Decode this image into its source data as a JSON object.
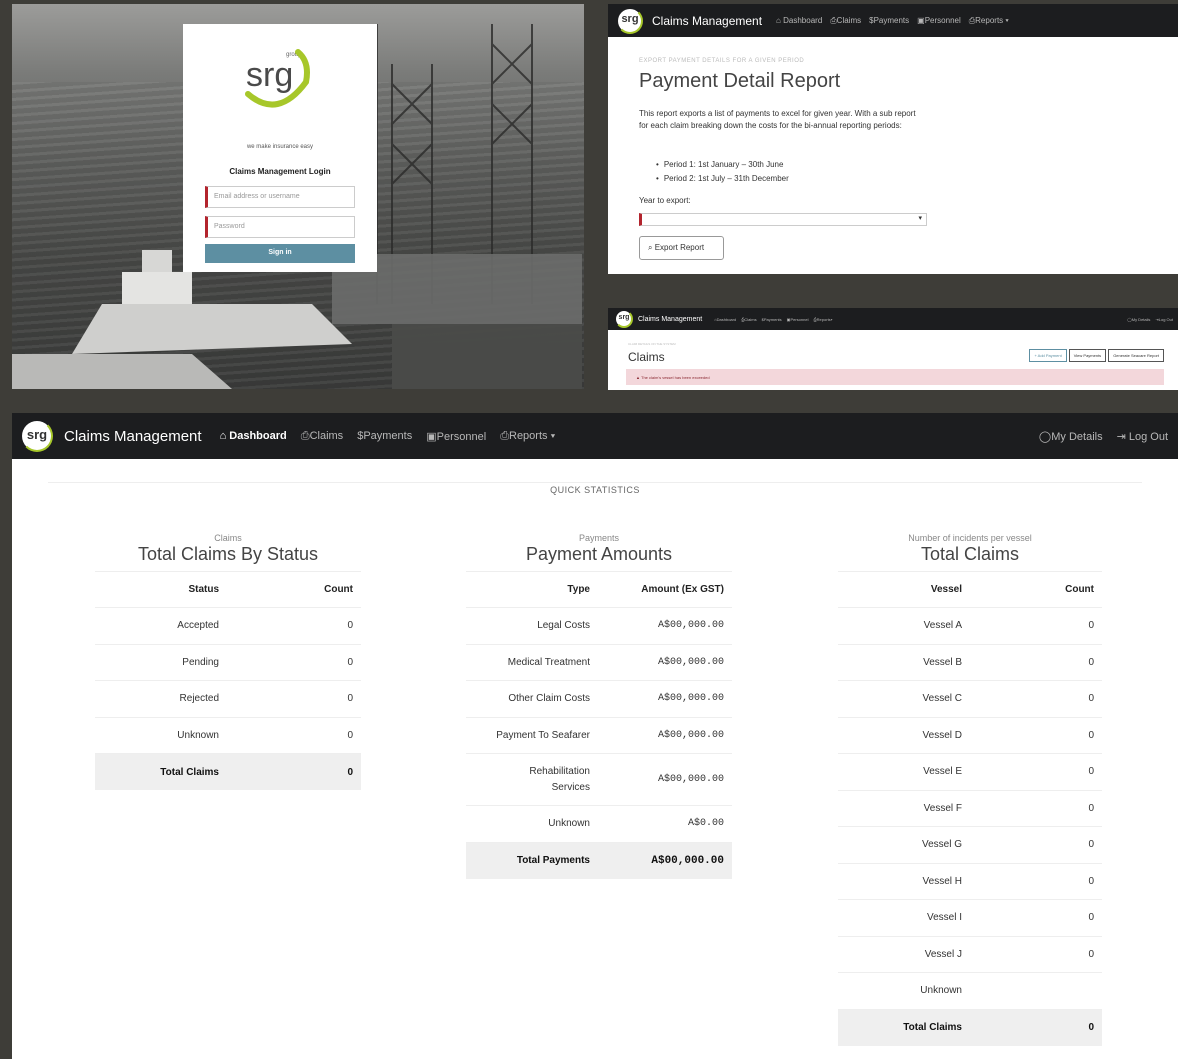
{
  "login": {
    "logo_text": "srg",
    "logo_small": "group",
    "tagline": "we make insurance easy",
    "heading": "Claims Management Login",
    "username_placeholder": "Email address or username",
    "password_placeholder": "Password",
    "signin_label": "Sign in"
  },
  "nav": {
    "logo_text": "srg",
    "brand": "Claims Management",
    "items": [
      {
        "icon": "home-icon",
        "glyph": "⌂",
        "label": "Dashboard"
      },
      {
        "icon": "document-icon",
        "glyph": "⎙",
        "label": "Claims"
      },
      {
        "icon": "dollar-icon",
        "glyph": "$",
        "label": "Payments"
      },
      {
        "icon": "person-card-icon",
        "glyph": "▣",
        "label": "Personnel"
      },
      {
        "icon": "report-icon",
        "glyph": "⎙",
        "label": "Reports",
        "caret": "▾"
      }
    ],
    "right_items": [
      {
        "icon": "user-circle-icon",
        "glyph": "◯",
        "label": "My Details"
      },
      {
        "icon": "logout-icon",
        "glyph": "⇥",
        "label": "Log Out"
      }
    ]
  },
  "report": {
    "kicker": "EXPORT PAYMENT DETAILS FOR A GIVEN PERIOD",
    "title": "Payment Detail Report",
    "description": "This report exports a list of payments to excel for given year. With a sub report for each claim breaking down the costs for the bi-annual reporting periods:",
    "periods": [
      "Period 1: 1st January – 30th June",
      "Period 2: 1st July – 31th December"
    ],
    "year_label": "Year to export:",
    "export_label": "Export Report",
    "export_icon": "⌕",
    "caret": "▾"
  },
  "claims_page": {
    "kicker": "CLAIM DETAILS ON THE SYSTEM",
    "title": "Claims",
    "buttons": [
      "+ Add Payment",
      "View Payments",
      "Generate Seacare Report"
    ],
    "alert": "▲ The claim's vessel has been exceeded"
  },
  "dashboard": {
    "section_label": "QUICK STATISTICS",
    "claims": {
      "subtitle": "Claims",
      "title": "Total Claims By Status",
      "headers": [
        "Status",
        "Count"
      ],
      "rows": [
        [
          "Accepted",
          "0"
        ],
        [
          "Pending",
          "0"
        ],
        [
          "Rejected",
          "0"
        ],
        [
          "Unknown",
          "0"
        ]
      ],
      "total": [
        "Total Claims",
        "0"
      ]
    },
    "payments": {
      "subtitle": "Payments",
      "title": "Payment Amounts",
      "headers": [
        "Type",
        "Amount (Ex GST)"
      ],
      "rows": [
        [
          "Legal Costs",
          "A$00,000.00"
        ],
        [
          "Medical Treatment",
          "A$00,000.00"
        ],
        [
          "Other Claim Costs",
          "A$00,000.00"
        ],
        [
          "Payment To Seafarer",
          "A$00,000.00"
        ],
        [
          "Rehabilitation Services",
          "A$00,000.00"
        ],
        [
          "Unknown",
          "A$0.00"
        ]
      ],
      "total": [
        "Total Payments",
        "A$00,000.00"
      ]
    },
    "vessels": {
      "subtitle": "Number of incidents per vessel",
      "title": "Total Claims",
      "headers": [
        "Vessel",
        "Count"
      ],
      "rows": [
        [
          "Vessel A",
          "0"
        ],
        [
          "Vessel B",
          "0"
        ],
        [
          "Vessel C",
          "0"
        ],
        [
          "Vessel D",
          "0"
        ],
        [
          "Vessel E",
          "0"
        ],
        [
          "Vessel F",
          "0"
        ],
        [
          "Vessel G",
          "0"
        ],
        [
          "Vessel H",
          "0"
        ],
        [
          "Vessel I",
          "0"
        ],
        [
          "Vessel J",
          "0"
        ],
        [
          "Unknown",
          ""
        ]
      ],
      "total": [
        "Total Claims",
        "0"
      ]
    }
  },
  "colors": {
    "nav_bg": "#1c1d1f",
    "accent_green": "#a7c72a",
    "signin_blue": "#5d8fa2",
    "required_red": "#b3242d",
    "alert_pink": "#f3d7db"
  }
}
